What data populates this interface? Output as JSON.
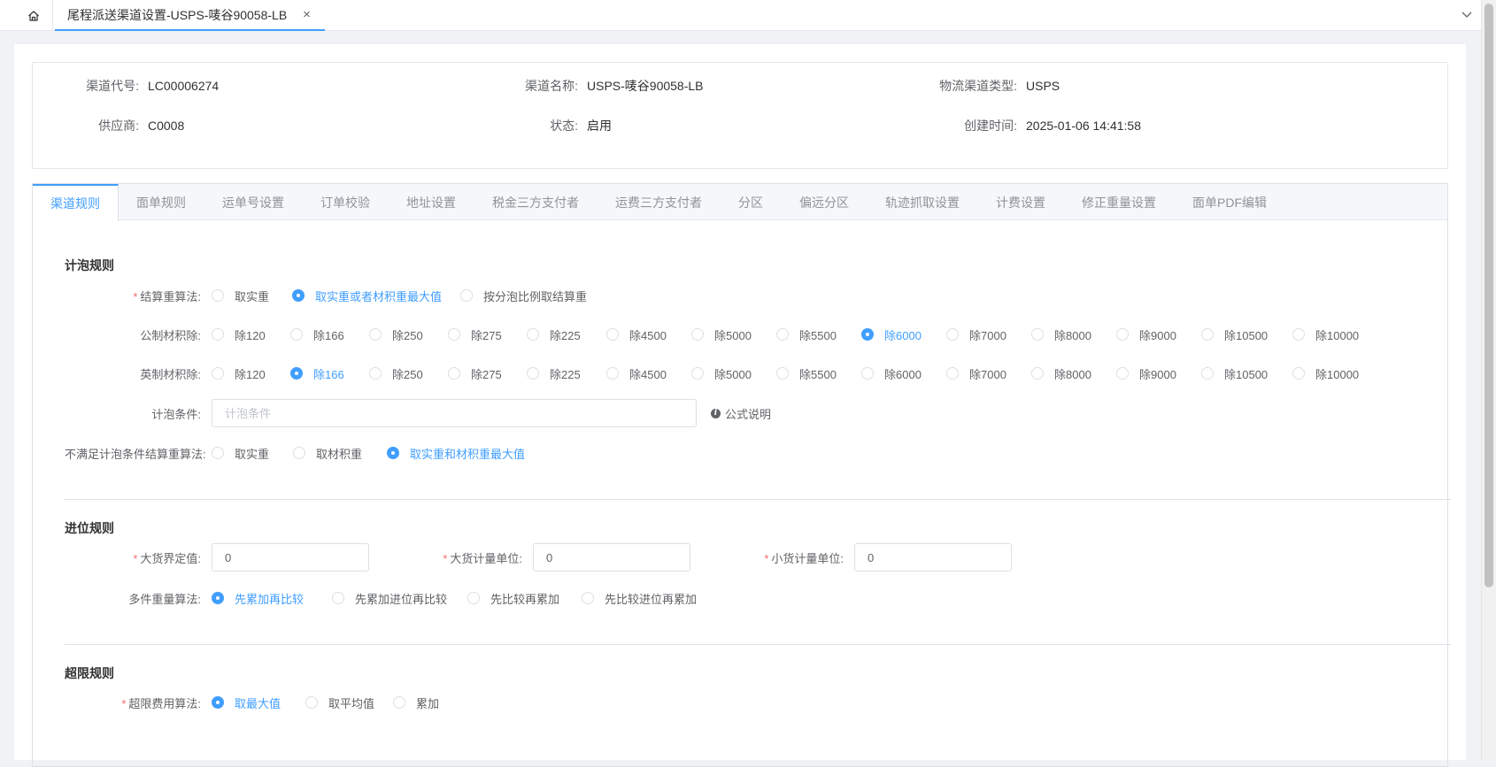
{
  "topbar": {
    "home_icon": "home-icon",
    "tab_title": "尾程派送渠道设置-USPS-唛谷90058-LB",
    "close_symbol": "×",
    "collapse_icon": "chevron-down-icon"
  },
  "info": {
    "code_label": "渠道代号:",
    "code_value": "LC00006274",
    "name_label": "渠道名称:",
    "name_value": "USPS-唛谷90058-LB",
    "type_label": "物流渠道类型:",
    "type_value": "USPS",
    "supplier_label": "供应商:",
    "supplier_value": "C0008",
    "status_label": "状态:",
    "status_value": "启用",
    "created_label": "创建时间:",
    "created_value": "2025-01-06 14:41:58"
  },
  "tabs": [
    "渠道规则",
    "面单规则",
    "运单号设置",
    "订单校验",
    "地址设置",
    "税金三方支付者",
    "运费三方支付者",
    "分区",
    "偏远分区",
    "轨迹抓取设置",
    "计费设置",
    "修正重量设置",
    "面单PDF编辑"
  ],
  "active_tab": "渠道规则",
  "foam": {
    "title": "计泡规则",
    "weight_algo_label": "结算重算法:",
    "weight_algo_options": [
      "取实重",
      "取实重或者材积重最大值",
      "按分泡比例取结算重"
    ],
    "weight_algo_selected": "取实重或者材积重最大值",
    "metric_label": "公制材积除:",
    "divisor_options": [
      "除120",
      "除166",
      "除250",
      "除275",
      "除225",
      "除4500",
      "除5000",
      "除5500",
      "除6000",
      "除7000",
      "除8000",
      "除9000",
      "除10500",
      "除10000"
    ],
    "metric_selected": "除6000",
    "imperial_label": "英制材积除:",
    "imperial_selected": "除166",
    "condition_label": "计泡条件:",
    "condition_placeholder": "计泡条件",
    "condition_value": "",
    "formula_help": "公式说明",
    "unmet_label": "不满足计泡条件结算重算法:",
    "unmet_options": [
      "取实重",
      "取材积重",
      "取实重和材积重最大值"
    ],
    "unmet_selected": "取实重和材积重最大值"
  },
  "carry": {
    "title": "进位规则",
    "bulk_threshold_label": "大货界定值:",
    "bulk_threshold_value": "0",
    "bulk_unit_label": "大货计量单位:",
    "bulk_unit_value": "0",
    "small_unit_label": "小货计量单位:",
    "small_unit_value": "0",
    "multi_label": "多件重量算法:",
    "multi_options": [
      "先累加再比较",
      "先累加进位再比较",
      "先比较再累加",
      "先比较进位再累加"
    ],
    "multi_selected": "先累加再比较"
  },
  "overlimit": {
    "title": "超限规则",
    "fee_label": "超限费用算法:",
    "fee_options": [
      "取最大值",
      "取平均值",
      "累加"
    ],
    "fee_selected": "取最大值"
  },
  "colors": {
    "primary": "#409eff",
    "required": "#f56c6c"
  }
}
